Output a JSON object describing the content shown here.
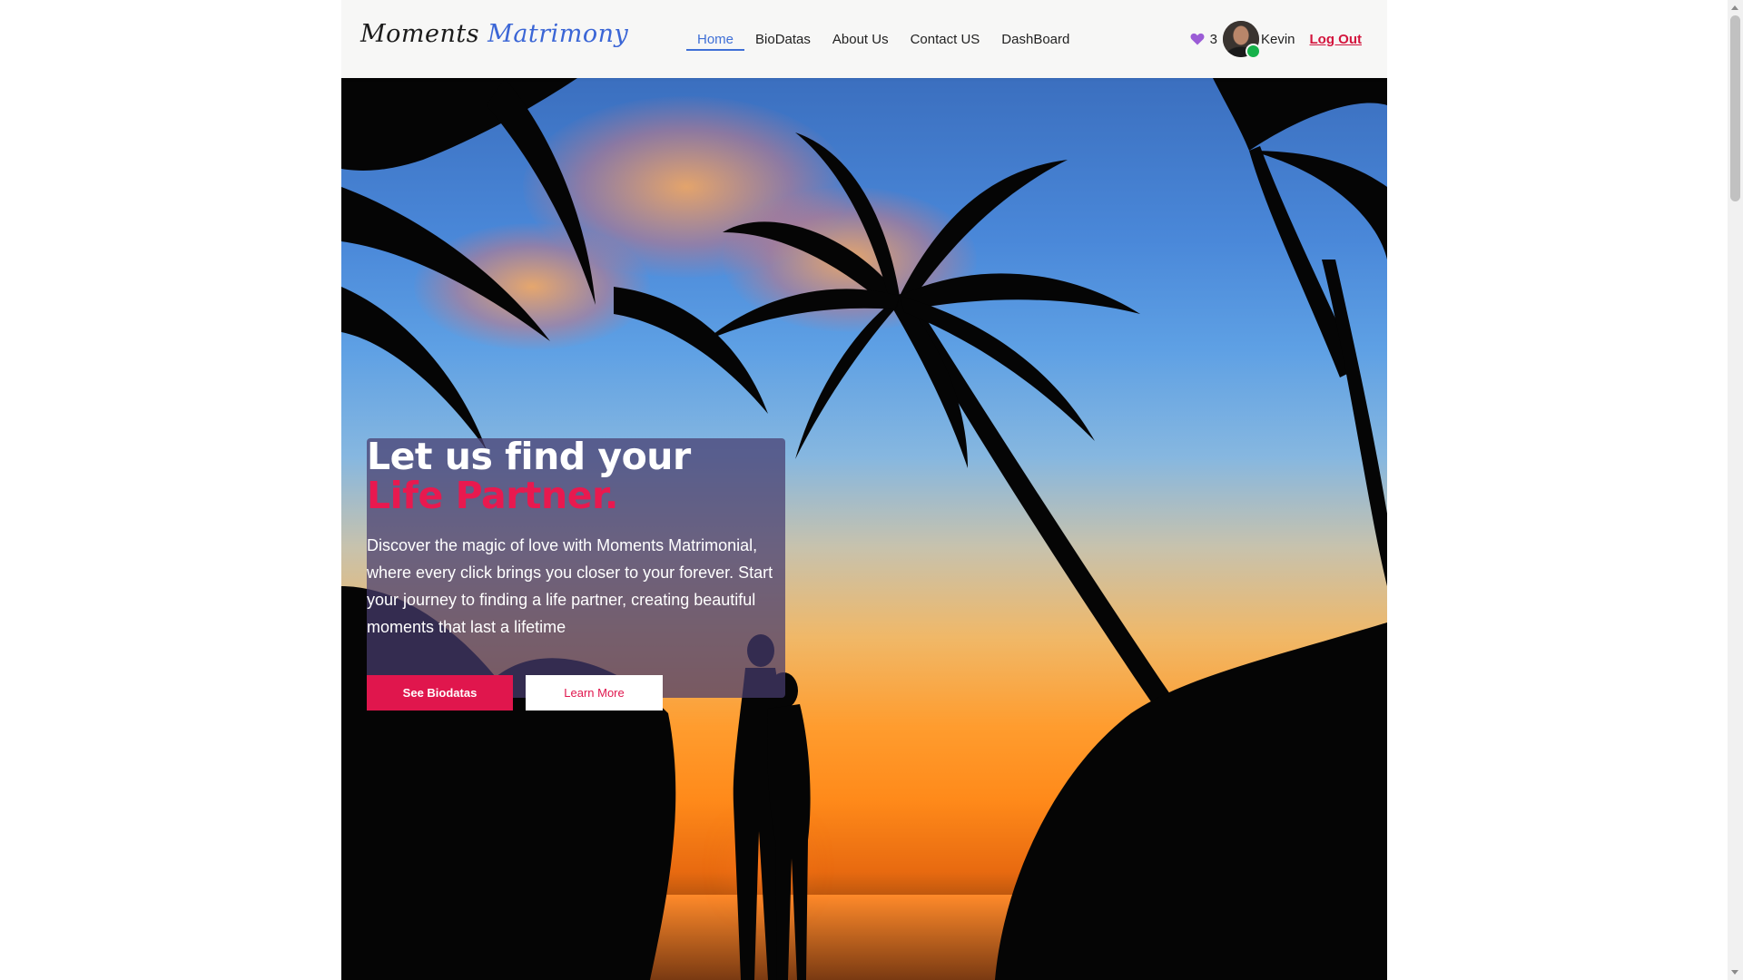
{
  "brand": {
    "part1": "Moments",
    "part2": "Matrimony",
    "accent_color": "#3b66d6"
  },
  "nav": {
    "links": [
      {
        "label": "Home",
        "active": true
      },
      {
        "label": "BioDatas",
        "active": false
      },
      {
        "label": "About Us",
        "active": false
      },
      {
        "label": "Contact US",
        "active": false
      },
      {
        "label": "DashBoard",
        "active": false
      }
    ],
    "active_color": "#3f6fd6"
  },
  "user": {
    "favorites_icon": "heart-icon",
    "favorites_count": "3",
    "name": "Kevin",
    "online": true,
    "logout_label": "Log Out"
  },
  "hero": {
    "title_line1": "Let us find your",
    "title_line2": "Life Partner.",
    "description": "Discover the magic of love with Moments Matrimonial, where every click brings you closer to your forever. Start your journey to finding a life partner, creating beautiful moments that last a lifetime",
    "primary_button": "See Biodatas",
    "secondary_button": "Learn More",
    "accent_color": "#e0164d"
  }
}
